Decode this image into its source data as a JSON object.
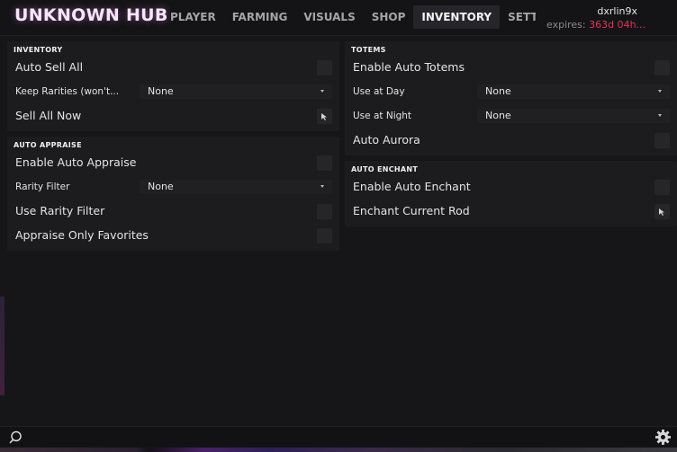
{
  "header": {
    "brand": "UNKNOWN HUB",
    "tabs": [
      "PLAYER",
      "FARMING",
      "VISUALS",
      "SHOP",
      "INVENTORY",
      "SETT"
    ],
    "active_tab": "INVENTORY",
    "username": "dxrlin9x",
    "expires_label": "expires:",
    "expires_value": "363d 04h..."
  },
  "left": {
    "inventory": {
      "title": "INVENTORY",
      "auto_sell_all": "Auto Sell All",
      "keep_rarities": "Keep Rarities (won't...",
      "keep_rarities_value": "None",
      "sell_all_now": "Sell All Now"
    },
    "auto_appraise": {
      "title": "AUTO APPRAISE",
      "enable_auto_appraise": "Enable Auto Appraise",
      "rarity_filter": "Rarity Filter",
      "rarity_filter_value": "None",
      "use_rarity_filter": "Use Rarity Filter",
      "appraise_only_favorites": "Appraise Only Favorites"
    }
  },
  "right": {
    "totems": {
      "title": "TOTEMS",
      "enable_auto_totems": "Enable Auto Totems",
      "use_at_day": "Use at Day",
      "use_at_day_value": "None",
      "use_at_night": "Use at Night",
      "use_at_night_value": "None",
      "auto_aurora": "Auto Aurora"
    },
    "auto_enchant": {
      "title": "AUTO ENCHANT",
      "enable_auto_enchant": "Enable Auto Enchant",
      "enchant_current_rod": "Enchant Current Rod"
    }
  },
  "icons": {
    "search": "search-icon",
    "settings": "gear-icon",
    "button": "cursor-icon"
  },
  "colors": {
    "accent_expires": "#e5335a",
    "brand_glow": "#d278dc",
    "background": "#161618"
  }
}
